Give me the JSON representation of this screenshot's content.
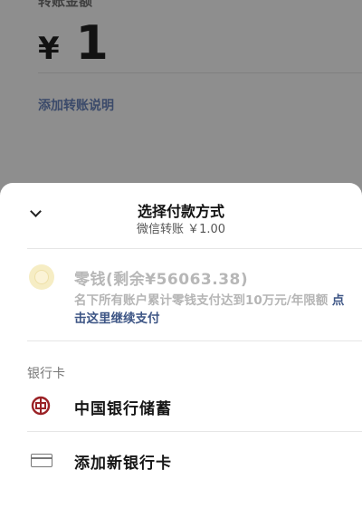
{
  "background": {
    "amount_label": "转账金额",
    "currency": "¥",
    "amount": "1",
    "add_note": "添加转账说明"
  },
  "sheet": {
    "title": "选择付款方式",
    "subtitle": "微信转账 ￥1.00",
    "change": {
      "title": "零钱(剩余¥56063.38)",
      "desc": "名下所有账户累计零钱支付达到10万元/年限额",
      "link": "点击这里继续支付"
    },
    "bank_section_label": "银行卡",
    "bank_card": {
      "label": "中国银行储蓄"
    },
    "add_card": {
      "label": "添加新银行卡"
    }
  },
  "colors": {
    "link": "#3d5585",
    "overlay": "#8e8e8e",
    "disabled_text": "#b7b7b7"
  }
}
